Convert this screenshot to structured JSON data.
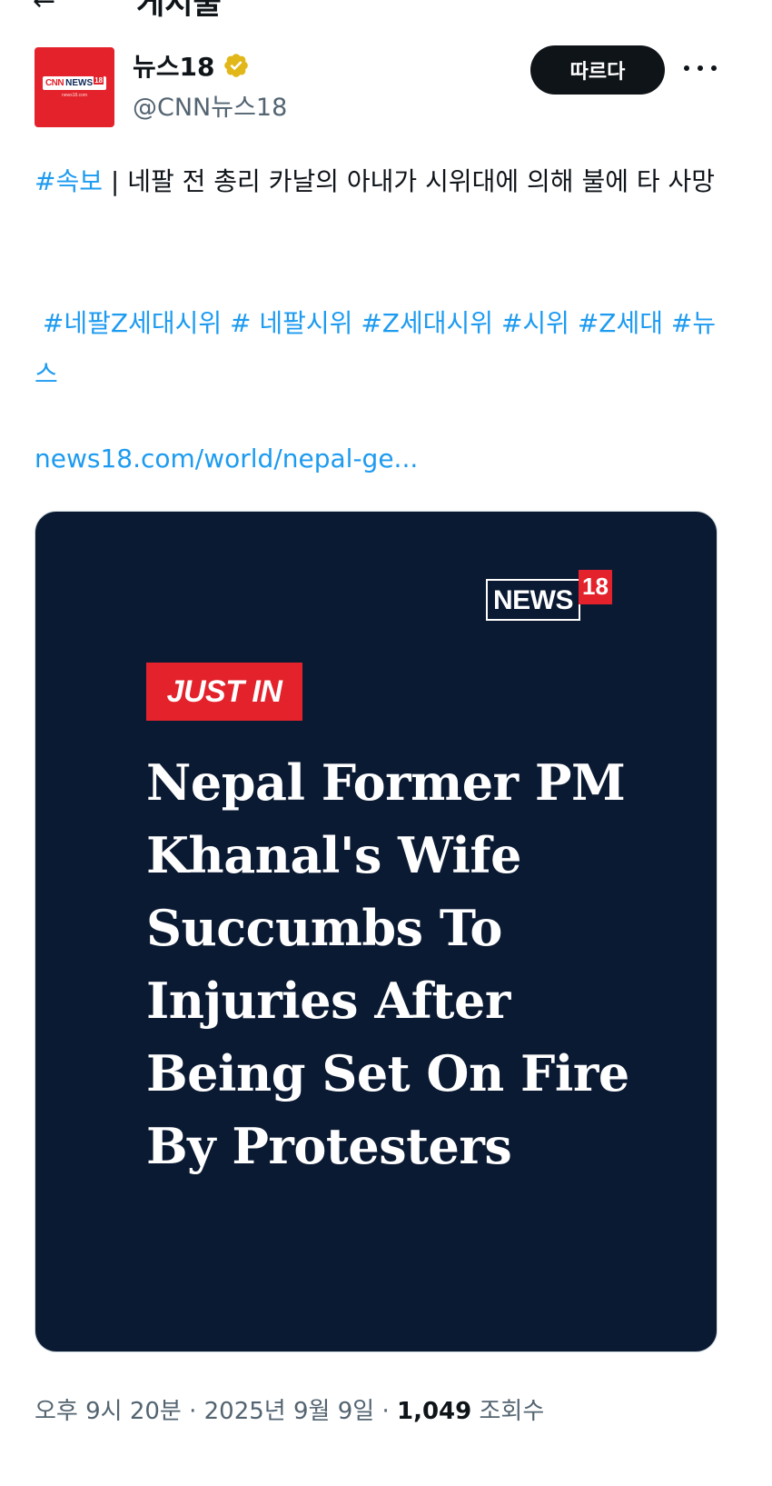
{
  "header": {
    "back_glyph": "←",
    "title": "게시물"
  },
  "account": {
    "avatar": {
      "logo_cnn": "CNN",
      "logo_news": "NEWS",
      "logo_18": "18",
      "logo_sub": "news18.com"
    },
    "display_name": "뉴스18",
    "handle": "@CNN뉴스18",
    "verified_icon": "verified-gold-badge",
    "follow_label": "따르다",
    "more_icon": "more-horizontal-icon"
  },
  "tweet": {
    "lead_hashtag": "#속보",
    "separator": " | ",
    "text": "네팔 전 총리 카날의 아내가 시위대에 의해 불에 타 사망",
    "hashtags": [
      "#네팔Z세대시위",
      "# 네팔시위",
      "#Z세대시위",
      "#시위",
      "#Z세대",
      "#뉴스"
    ],
    "link_text": "news18.com/world/nepal-ge..."
  },
  "card": {
    "brand_news": "NEWS",
    "brand_18": "18",
    "badge": "JUST IN",
    "headline_lines": [
      "Nepal Former PM",
      "Khanal's Wife",
      "Succumbs To",
      "Injuries After",
      "Being Set On Fire",
      "By Protesters"
    ]
  },
  "meta": {
    "time": "오후 9시 20분",
    "dot1": " · ",
    "date": "2025년 9월 9일",
    "dot2": " · ",
    "views_count": "1,049",
    "views_label": " 조회수"
  },
  "colors": {
    "link": "#1d9bf0",
    "card_bg": "#0b1a33",
    "brand_red": "#e3222b",
    "follow_bg": "#0f1419"
  }
}
